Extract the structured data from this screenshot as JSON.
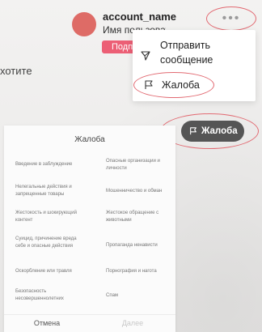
{
  "account": {
    "account_name": "account_name",
    "user_name": "Имя пользователя",
    "subscribe_label": "Подписаться"
  },
  "more_button": {
    "label": "•••"
  },
  "background_text": "хотите",
  "menu": {
    "send_message": "Отправить сообщение",
    "report": "Жалоба"
  },
  "report_pill": {
    "label": "Жалоба"
  },
  "report_dialog": {
    "title": "Жалоба",
    "reasons": [
      "Введение в заблуждение",
      "Опасные организации и личности",
      "Нелегальные действия и запрещенные товары",
      "Мошенничество и обман",
      "Жестокость и шокирующий контент",
      "Жестокое обращение с животными",
      "Суицид, причинение вреда себе и опасные действия",
      "Пропаганда ненависти",
      "Оскорбление или травля",
      "Порнография и нагота",
      "Безопасность несовершеннолетних",
      "Спам"
    ],
    "cancel": "Отмена",
    "next": "Далее"
  },
  "colors": {
    "accent": "#ec5f75",
    "highlight_ring": "#e26a72",
    "pill_bg": "#555555"
  }
}
